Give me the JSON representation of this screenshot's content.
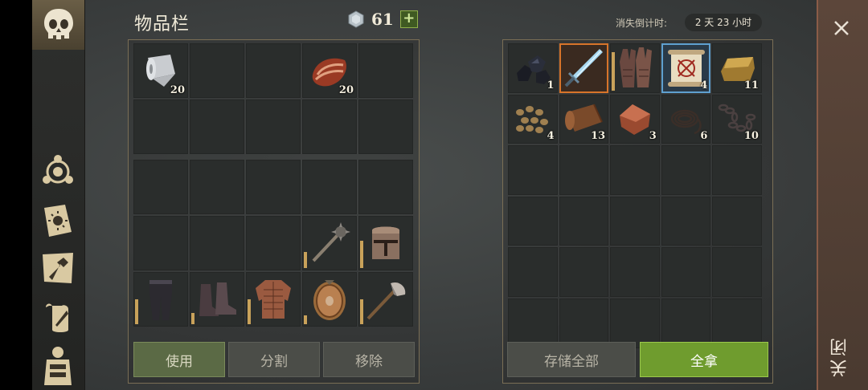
{
  "inventory": {
    "title": "物品栏",
    "currency": "61",
    "buttons": {
      "use": "使用",
      "split": "分割",
      "remove": "移除"
    },
    "top_cells": [
      {
        "icon": "cloth-roll-icon",
        "qty": "20"
      },
      {},
      {},
      {
        "icon": "meat-icon",
        "qty": "20"
      },
      {},
      {},
      {},
      {},
      {},
      {}
    ],
    "bottom_cells": [
      {},
      {},
      {},
      {},
      {},
      {},
      {},
      {},
      {
        "icon": "mace-icon",
        "durability": 0.35
      },
      {
        "icon": "great-helm-icon",
        "durability": 0.6
      },
      {
        "icon": "leather-pants-icon",
        "durability": 0.55
      },
      {
        "icon": "leather-boots-icon",
        "durability": 0.25
      },
      {
        "icon": "leather-jacket-icon",
        "durability": 0.55
      },
      {
        "icon": "round-shield-icon",
        "durability": 0.2
      },
      {
        "icon": "axe-icon",
        "durability": 0.55
      }
    ]
  },
  "loot": {
    "countdown_label": "消失倒计时:",
    "countdown_value": "2 天 23 小时",
    "buttons": {
      "store_all": "存储全部",
      "take_all": "全拿"
    },
    "cells": [
      {
        "icon": "coal-icon",
        "qty": "1"
      },
      {
        "icon": "ice-sword-icon",
        "selected": "orange"
      },
      {
        "icon": "leather-gloves-icon",
        "durability": 0.85
      },
      {
        "icon": "recipe-scroll-icon",
        "qty": "4",
        "selected": "blue"
      },
      {
        "icon": "bronze-ingot-icon",
        "qty": "11"
      },
      {
        "icon": "seeds-icon",
        "qty": "4"
      },
      {
        "icon": "leather-icon",
        "qty": "13"
      },
      {
        "icon": "copper-ingot-icon",
        "qty": "3"
      },
      {
        "icon": "rope-icon",
        "qty": "6"
      },
      {
        "icon": "chain-icon",
        "qty": "10"
      },
      {},
      {},
      {},
      {},
      {},
      {},
      {},
      {},
      {},
      {},
      {},
      {},
      {},
      {},
      {},
      {},
      {},
      {},
      {},
      {}
    ]
  },
  "close_label": "关闭",
  "colors": {
    "accent_green": "#6f9c2e",
    "frame_gold": "#7a6e55",
    "durability": "#c9a25a"
  }
}
